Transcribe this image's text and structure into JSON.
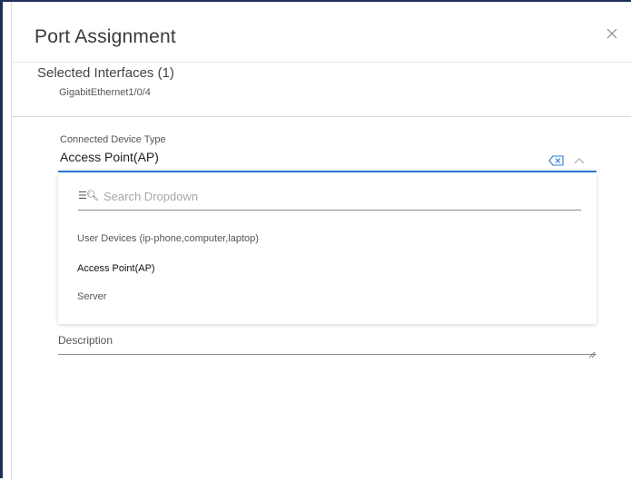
{
  "dialog": {
    "title": "Port Assignment",
    "close_icon": "close-icon"
  },
  "selected_interfaces": {
    "title": "Selected Interfaces (1)",
    "items": [
      "GigabitEthernet1/0/4"
    ]
  },
  "connected_device_type": {
    "label": "Connected Device Type",
    "value": "Access Point(AP)",
    "clear_icon": "backspace-clear-icon",
    "toggle_icon": "chevron-up-icon",
    "accent_color": "#2b7cd3"
  },
  "dropdown": {
    "search_placeholder": "Search Dropdown",
    "search_icon": "filter-search-icon",
    "options": [
      {
        "label": "User Devices (ip-phone,computer,laptop)",
        "selected": false
      },
      {
        "label": "Access Point(AP)",
        "selected": true
      },
      {
        "label": "Server",
        "selected": false
      }
    ]
  },
  "description": {
    "label": "Description",
    "value": ""
  }
}
